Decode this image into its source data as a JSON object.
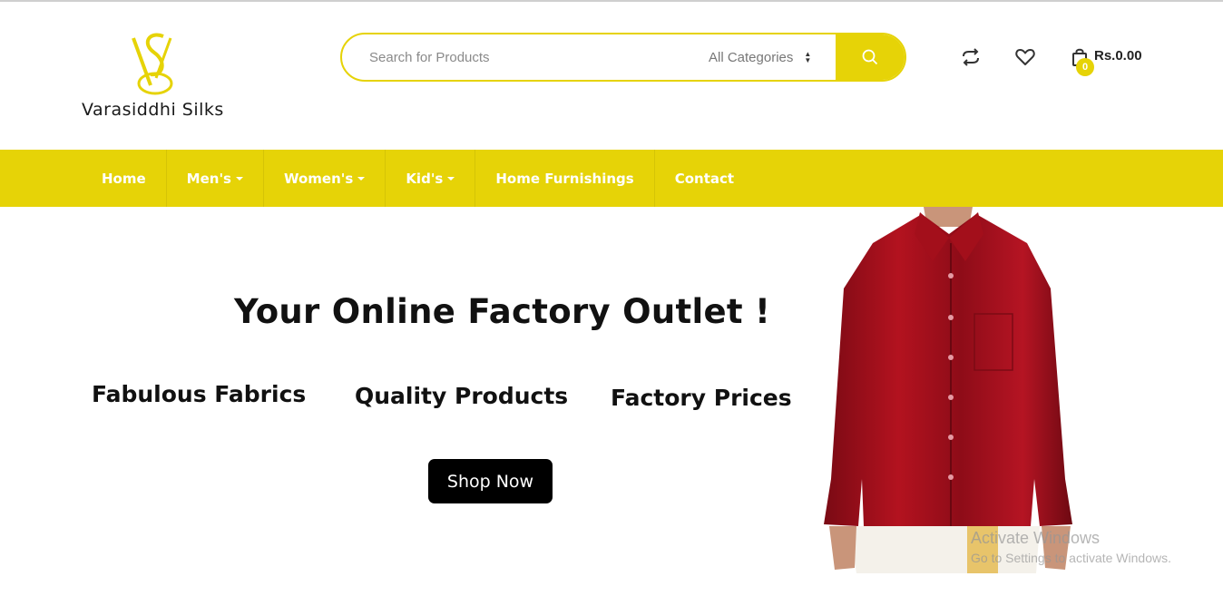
{
  "brand": {
    "name": "Varasiddhi Silks",
    "accent": "#e6d307"
  },
  "search": {
    "placeholder": "Search for Products",
    "category": "All Categories"
  },
  "header_icons": [
    "compare-icon",
    "heart-icon",
    "shopping-bag-icon"
  ],
  "cart": {
    "count": "0",
    "total": "Rs.0.00"
  },
  "nav": {
    "items": [
      {
        "label": "Home"
      },
      {
        "label": "Men's",
        "dropdown": true
      },
      {
        "label": "Women's",
        "dropdown": true
      },
      {
        "label": "Kid's",
        "dropdown": true
      },
      {
        "label": "Home Furnishings"
      },
      {
        "label": "Contact"
      }
    ]
  },
  "hero": {
    "title": "Your Online Factory Outlet !",
    "features": [
      "Fabulous Fabrics",
      "Quality Products",
      "Factory Prices"
    ],
    "cta": "Shop Now",
    "image": "model in red silk shirt"
  },
  "watermark": {
    "line1": "Activate Windows",
    "line2": "Go to Settings to activate Windows."
  }
}
